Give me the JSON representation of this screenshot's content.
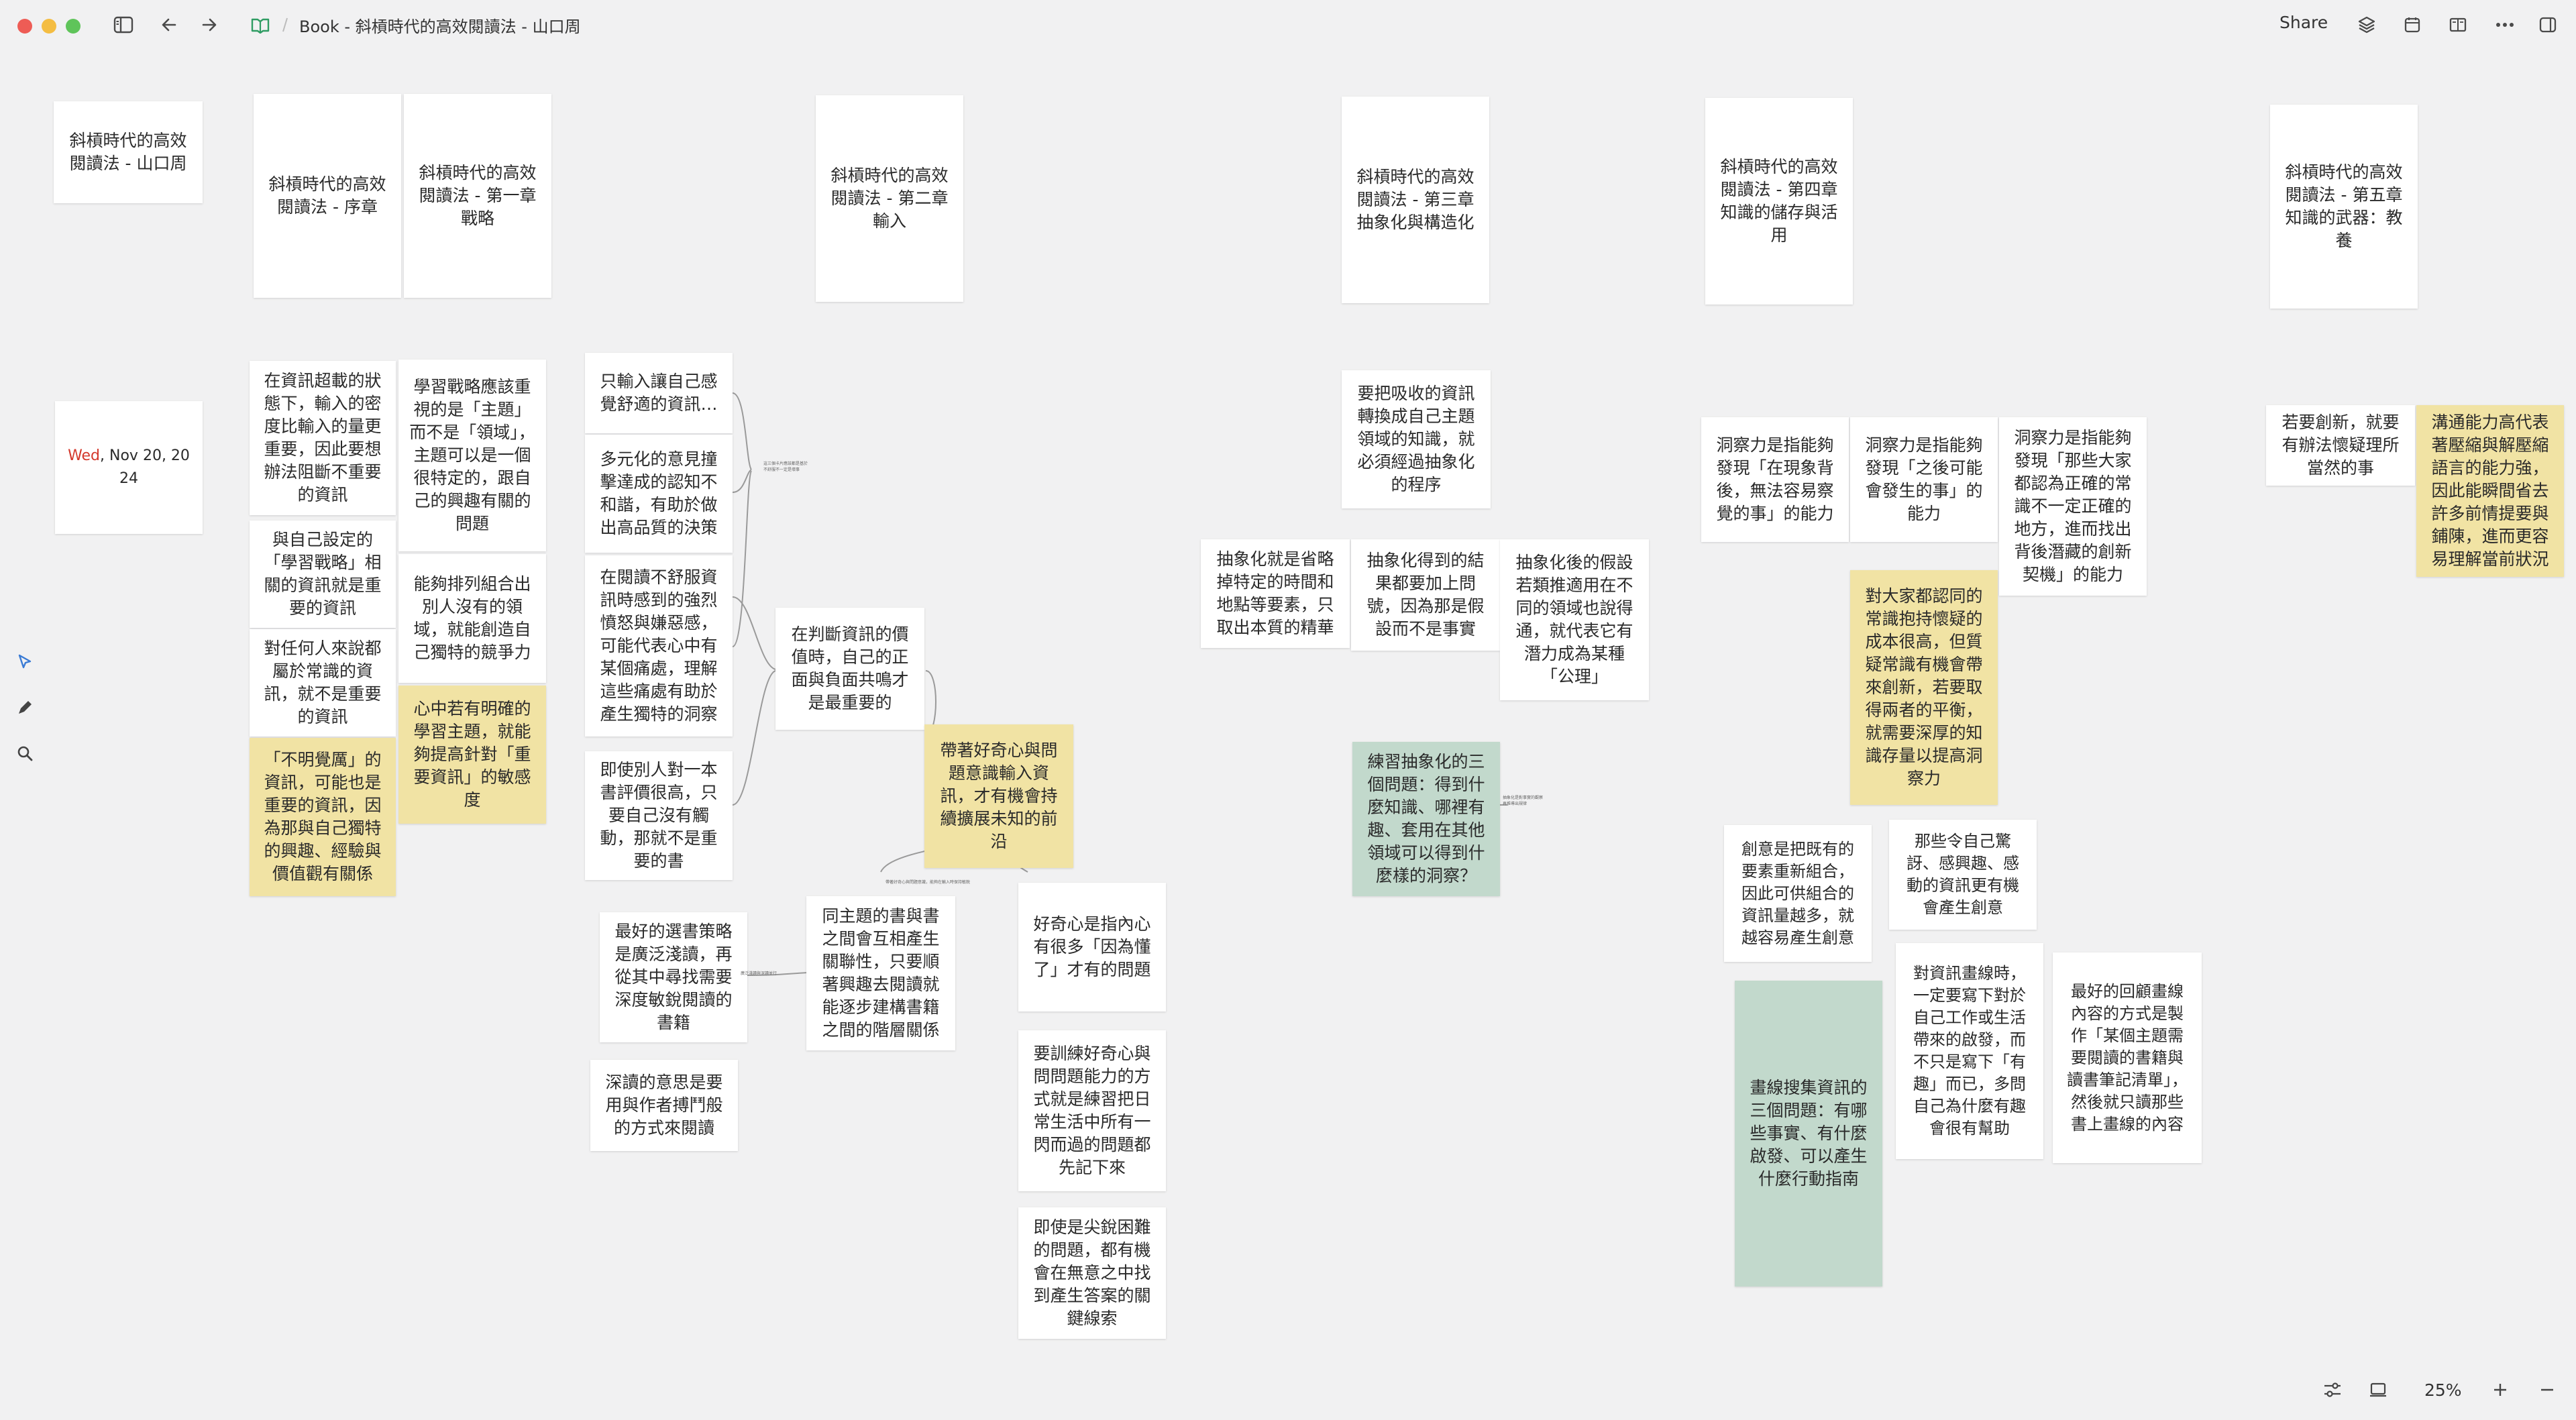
{
  "window": {
    "title": "Book - 斜槓時代的高效閱讀法 - 山口周",
    "share_label": "Share",
    "zoom": "25%"
  },
  "icons": {
    "sidebar": "sidebar-toggle-icon",
    "back": "arrow-left-icon",
    "forward": "arrow-right-icon",
    "board": "board-icon",
    "layers": "layers-icon",
    "calendar": "calendar-icon",
    "book": "book-icon",
    "more": "more-icon",
    "pointer": "pointer-icon",
    "pen": "pen-icon",
    "search": "search-icon",
    "settings": "sliders-icon",
    "fit": "fit-screen-icon",
    "zoom_in": "zoom-in-icon",
    "zoom_out": "zoom-out-icon"
  },
  "colors": {
    "yellow_card": "#f1e3a4",
    "green_card": "#c2d9cc",
    "date_accent": "#d4382c"
  },
  "date": {
    "day": "Wed",
    "rest": ", Nov 20, 2024"
  },
  "headers": {
    "book": "斜槓時代的高效閱讀法 - 山口周",
    "prologue": "斜槓時代的高效閱讀法 - 序章",
    "ch1": "斜槓時代的高效閱讀法 - 第一章 戰略",
    "ch2": "斜槓時代的高效閱讀法 - 第二章 輸入",
    "ch3": "斜槓時代的高效閱讀法 - 第三章 抽象化與構造化",
    "ch4": "斜槓時代的高效閱讀法 - 第四章 知識的儲存與活用",
    "ch5": "斜槓時代的高效閱讀法 - 第五章 知識的武器：教養"
  },
  "prologue_notes": {
    "n1": "在資訊超載的狀態下，輸入的密度比輸入的量更重要，因此要想辦法阻斷不重要的資訊",
    "n2": "與自己設定的「學習戰略」相關的資訊就是重要的資訊",
    "n3": "對任何人來說都屬於常識的資訊，就不是重要的資訊",
    "n4": "「不明覺厲」的資訊，可能也是重要的資訊，因為那與自己獨特的興趣、經驗與價值觀有關係"
  },
  "ch1_notes": {
    "n1": "學習戰略應該重視的是「主題」而不是「領域」，主題可以是一個很特定的，跟自己的興趣有關的問題",
    "n2": "能夠排列組合出別人沒有的領域，就能創造自己獨特的競爭力",
    "n3": "心中若有明確的學習主題，就能夠提高針對「重要資訊」的敏感度"
  },
  "ch2_notes": {
    "n1": "只輸入讓自己感覺舒適的資訊…",
    "n2": "多元化的意見撞擊達成的認知不和諧，有助於做出高品質的決策",
    "n3": "在閱讀不舒服資訊時感到的強烈憤怒與嫌惡感，可能代表心中有某個痛處，理解這些痛處有助於產生獨特的洞察",
    "n4": "即使別人對一本書評價很高，只要自己沒有觸動，那就不是重要的書",
    "n5": "在判斷資訊的價值時，自己的正面與負面共鳴才是最重要的",
    "n6": "帶著好奇心與問題意識輸入資訊，才有機會持續擴展未知的前沿",
    "n7": "最好的選書策略是廣泛淺讀，再從其中尋找需要深度敏銳閱讀的書籍",
    "n8": "深讀的意思是要用與作者搏鬥般的方式來閱讀",
    "n9": "同主題的書與書之間會互相產生關聯性，只要順著興趣去閱讀就能逐步建構書籍之間的階層關係",
    "n10": "好奇心是指內心有很多「因為懂了」才有的問題",
    "n11": "要訓練好奇心與問問題能力的方式就是練習把日常生活中所有一閃而過的問題都先記下來",
    "n12": "即使是尖銳困難的問題，都有機會在無意之中找到產生答案的關鍵線索"
  },
  "ch2_tiny": {
    "t1": "這三個卡片應該都是基於",
    "t2": "不舒服不一定是壞事",
    "t3": "帶著好奇心與問題意識，能夠在輸入時保持敏銳",
    "t4": "廣泛淺讀與深讀並行"
  },
  "ch3_notes": {
    "n1": "要把吸收的資訊轉換成自己主題領域的知識，就必須經過抽象化的程序",
    "n2": "抽象化就是省略掉特定的時間和地點等要素，只取出本質的精華",
    "n3": "抽象化得到的結果都要加上問號，因為那是假設而不是事實",
    "n4": "抽象化後的假設若類推適用在不同的領域也說得通，就代表它有潛力成為某種「公理」",
    "n5": "練習抽象化的三個問題：得到什麼知識、哪裡有趣、套用在其他領域可以得到什麼樣的洞察？"
  },
  "ch3_tiny": {
    "t1": "抽象化是對事實的觀察",
    "t2": "再推導出規律"
  },
  "ch4_notes": {
    "n1": "洞察力是指能夠發現「在現象背後，無法容易察覺的事」的能力",
    "n2": "洞察力是指能夠發現「之後可能會發生的事」的能力",
    "n3": "洞察力是指能夠發現「那些大家都認為正確的常識不一定正確的地方，進而找出背後潛藏的創新契機」的能力",
    "n4": "對大家都認同的常識抱持懷疑的成本很高，但質疑常識有機會帶來創新，若要取得兩者的平衡，就需要深厚的知識存量以提高洞察力",
    "n5": "創意是把既有的要素重新組合，因此可供組合的資訊量越多，就越容易產生創意",
    "n6": "那些令自己驚訝、感興趣、感動的資訊更有機會產生創意",
    "n7": "畫線搜集資訊的三個問題：有哪些事實、有什麼啟發、可以產生什麼行動指南",
    "n8": "對資訊畫線時，一定要寫下對於自己工作或生活帶來的啟發，而不只是寫下「有趣」而已，多問自己為什麼有趣會很有幫助",
    "n9": "最好的回顧畫線內容的方式是製作「某個主題需要閱讀的書籍與讀書筆記清單」，然後就只讀那些書上畫線的內容"
  },
  "ch5_notes": {
    "n1": "若要創新，就要有辦法懷疑理所當然的事",
    "n2": "溝通能力高代表著壓縮與解壓縮語言的能力強，因此能瞬間省去許多前情提要與鋪陳，進而更容易理解當前狀況"
  }
}
